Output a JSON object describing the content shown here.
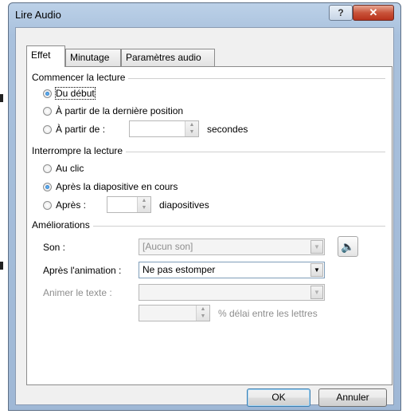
{
  "window": {
    "title": "Lire Audio",
    "help": "?",
    "close": "✕"
  },
  "tabs": [
    {
      "label": "Effet"
    },
    {
      "label": "Minutage"
    },
    {
      "label": "Paramètres audio"
    }
  ],
  "start_group": {
    "title": "Commencer la lecture",
    "options": [
      {
        "label": "Du début",
        "checked": true
      },
      {
        "label": "À partir de la dernière position",
        "checked": false
      },
      {
        "label": "À partir de :",
        "checked": false
      }
    ],
    "seconds_value": "",
    "seconds_unit": "secondes"
  },
  "stop_group": {
    "title": "Interrompre la lecture",
    "options": [
      {
        "label": "Au clic",
        "checked": false
      },
      {
        "label": "Après la diapositive en cours",
        "checked": true
      },
      {
        "label": "Après :",
        "checked": false
      }
    ],
    "slides_value": "",
    "slides_unit": "diapositives"
  },
  "enhancements": {
    "title": "Améliorations",
    "sound_label": "Son :",
    "sound_value": "[Aucun son]",
    "after_anim_label": "Après l'animation :",
    "after_anim_value": "Ne pas estomper",
    "animate_text_label": "Animer le texte :",
    "animate_text_value": "",
    "delay_value": "",
    "delay_label": "% délai entre les lettres"
  },
  "buttons": {
    "ok": "OK",
    "cancel": "Annuler"
  }
}
